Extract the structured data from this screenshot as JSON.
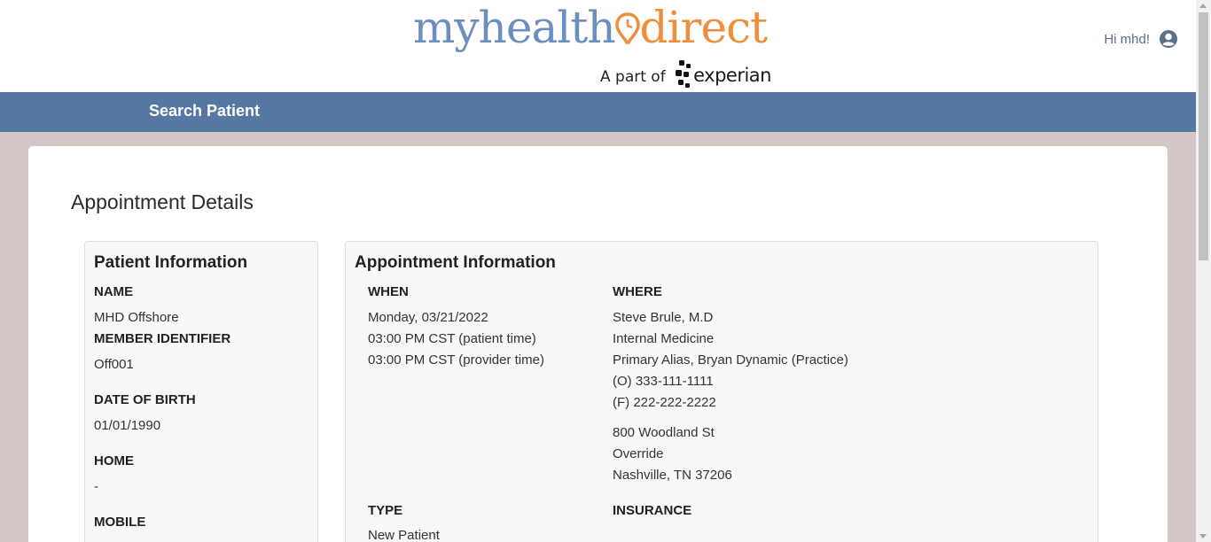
{
  "header": {
    "logo_my": "myhealth",
    "logo_direct": "direct",
    "logo_tagline": "A part of",
    "logo_partner": "experian",
    "greeting": "Hi mhd!"
  },
  "nav": {
    "search_patient": "Search Patient"
  },
  "page": {
    "title": "Appointment Details"
  },
  "patient": {
    "heading": "Patient Information",
    "name_label": "NAME",
    "name_value": "MHD Offshore",
    "member_label": "MEMBER IDENTIFIER",
    "member_value": "Off001",
    "dob_label": "DATE OF BIRTH",
    "dob_value": "01/01/1990",
    "home_label": "HOME",
    "home_value": "-",
    "mobile_label": "MOBILE"
  },
  "appointment": {
    "heading": "Appointment Information",
    "when_label": "WHEN",
    "when_lines": [
      "Monday, 03/21/2022",
      "03:00 PM CST (patient time)",
      "03:00 PM CST (provider time)"
    ],
    "where_label": "WHERE",
    "where_lines": [
      "Steve Brule, M.D",
      "Internal Medicine",
      "Primary Alias, Bryan Dynamic (Practice)",
      "(O) 333-111-1111",
      "(F) 222-222-2222"
    ],
    "address_lines": [
      "800 Woodland St",
      "Override",
      "Nashville, TN 37206"
    ],
    "type_label": "TYPE",
    "type_value": "New Patient",
    "insurance_label": "INSURANCE"
  },
  "colors": {
    "navbar": "#5578a3",
    "logo_blue": "#6d8fbf",
    "logo_orange": "#ee8f3c",
    "background": "#d3c8c6"
  }
}
